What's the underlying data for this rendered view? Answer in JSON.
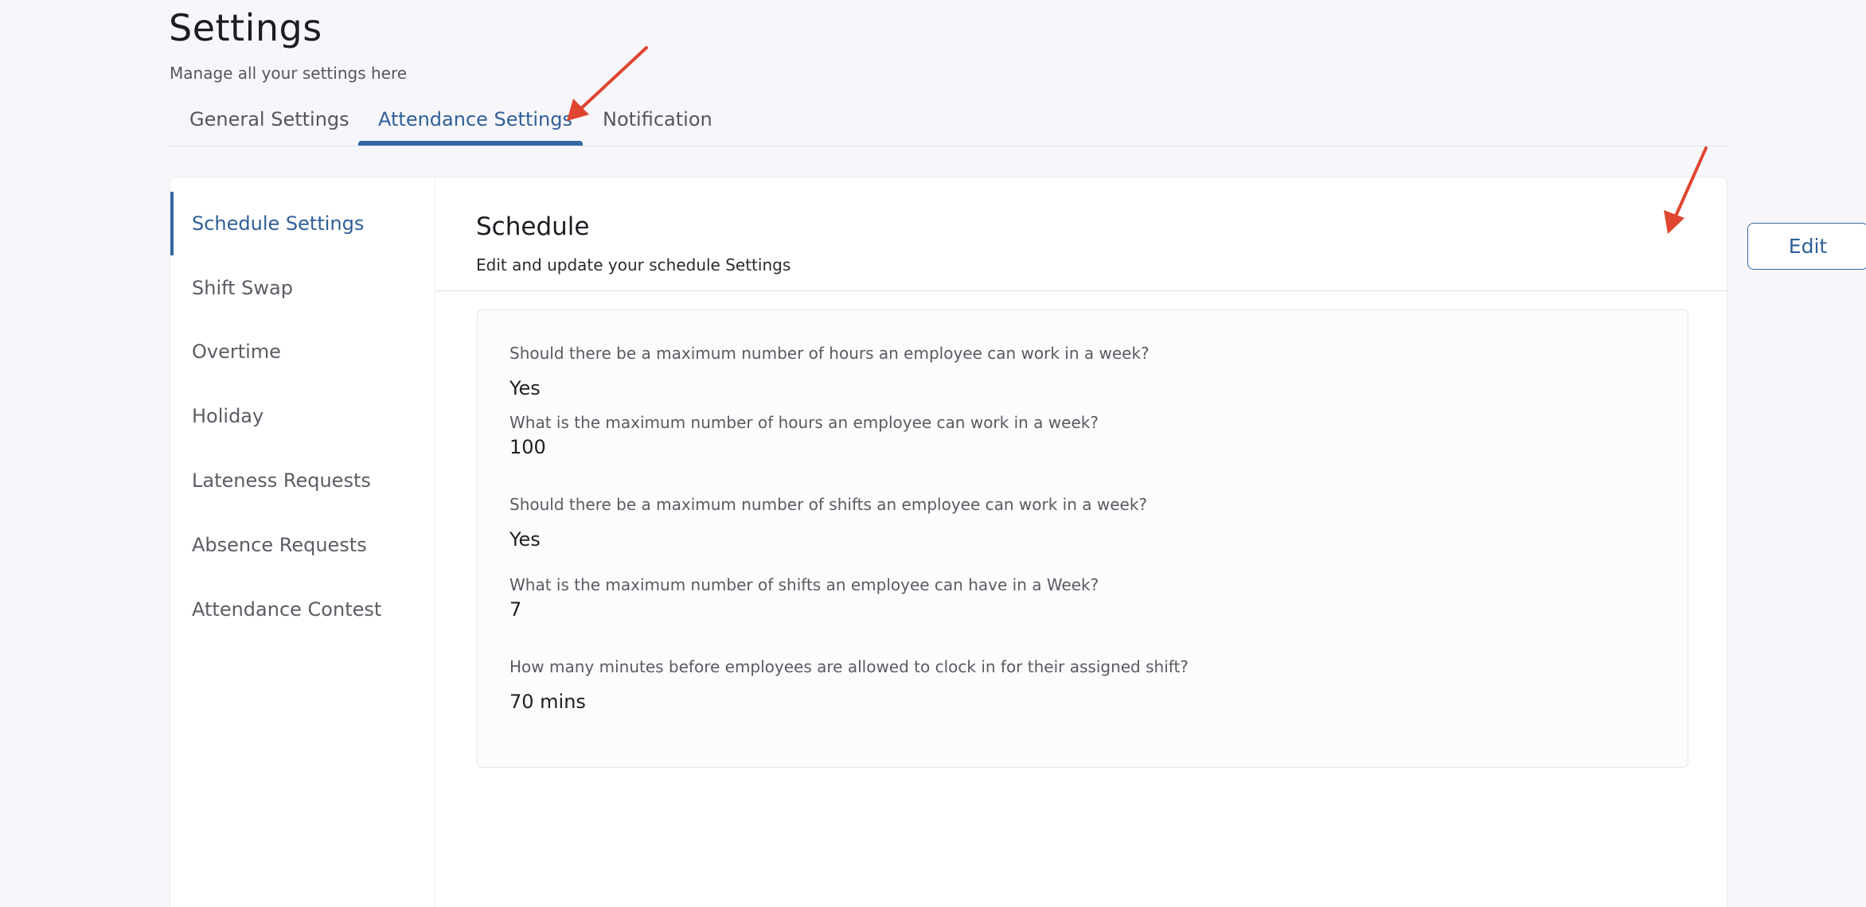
{
  "header": {
    "title": "Settings",
    "subtitle": "Manage all your settings here"
  },
  "tabs": [
    {
      "label": "General Settings",
      "active": false
    },
    {
      "label": "Attendance Settings",
      "active": true
    },
    {
      "label": "Notification",
      "active": false
    }
  ],
  "sidebar": {
    "items": [
      {
        "label": "Schedule Settings",
        "active": true
      },
      {
        "label": "Shift Swap",
        "active": false
      },
      {
        "label": "Overtime",
        "active": false
      },
      {
        "label": "Holiday",
        "active": false
      },
      {
        "label": "Lateness Requests",
        "active": false
      },
      {
        "label": "Absence Requests",
        "active": false
      },
      {
        "label": "Attendance Contest",
        "active": false
      }
    ]
  },
  "section": {
    "title": "Schedule",
    "subtitle": "Edit and update your schedule Settings",
    "edit_label": "Edit"
  },
  "settings": [
    {
      "question": "Should there be a maximum number of hours an employee can work in a week?",
      "answer": "Yes"
    },
    {
      "question": "What is the maximum number of hours an employee can work in a week?",
      "answer": "100"
    },
    {
      "question": "Should there be a maximum number of shifts an employee can work in a week?",
      "answer": "Yes"
    },
    {
      "question": "What is the maximum number of shifts an employee can have in a Week?",
      "answer": "7"
    },
    {
      "question": "How many minutes before employees are allowed to clock in for their assigned shift?",
      "answer": "70 mins"
    }
  ],
  "colors": {
    "accent": "#3467a3",
    "annotation_arrow": "#e0452f"
  },
  "icons": [
    "annotation-arrow-icon"
  ]
}
